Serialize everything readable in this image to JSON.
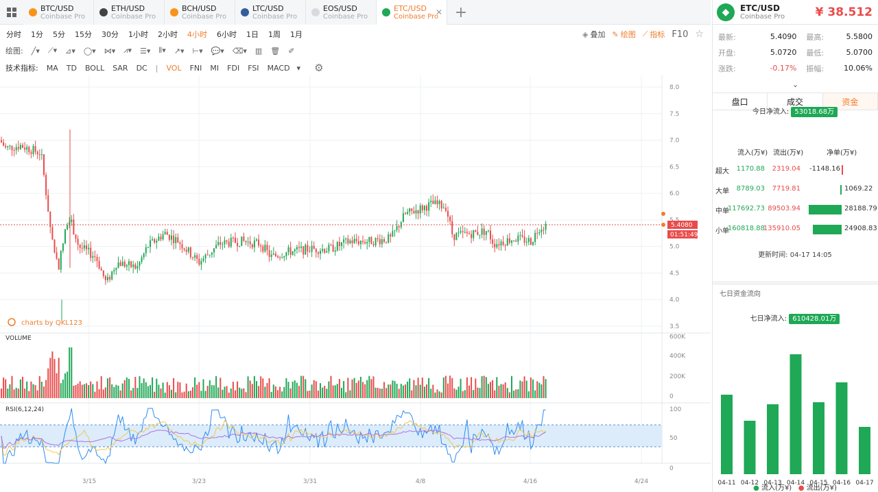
{
  "tabs": [
    {
      "symbol": "BTC/USD",
      "exchange": "Coinbase Pro",
      "color": "#f7931a",
      "active": false
    },
    {
      "symbol": "ETH/USD",
      "exchange": "Coinbase Pro",
      "color": "#444444",
      "active": false
    },
    {
      "symbol": "BCH/USD",
      "exchange": "Coinbase Pro",
      "color": "#f7931a",
      "active": false
    },
    {
      "symbol": "LTC/USD",
      "exchange": "Coinbase Pro",
      "color": "#345d9d",
      "active": false
    },
    {
      "symbol": "EOS/USD",
      "exchange": "Coinbase Pro",
      "color": "#d9d9e0",
      "active": false
    },
    {
      "symbol": "ETC/USD",
      "exchange": "Coinbase Pro",
      "color": "#1fa855",
      "active": true
    }
  ],
  "periods": [
    "分时",
    "1分",
    "5分",
    "15分",
    "30分",
    "1小时",
    "2小时",
    "4小时",
    "6小时",
    "1日",
    "1周",
    "1月"
  ],
  "active_period": "4小时",
  "toolbar_right": {
    "overlay": "叠加",
    "draw": "绘图",
    "indicator": "指标",
    "f10": "F10"
  },
  "draw_label": "绘图:",
  "indicator_label": "技术指标:",
  "indicators": [
    "MA",
    "TD",
    "BOLL",
    "SAR",
    "DC",
    "VOL",
    "FNI",
    "MI",
    "FDI",
    "FSI",
    "MACD"
  ],
  "active_indicator": "VOL",
  "chart_labels": {
    "watermark": "charts by QKL123",
    "volume": "VOLUME",
    "rsi": "RSI(6,12,24)",
    "price_tag": "5.4080",
    "countdown": "01:51:49"
  },
  "chart_data": {
    "type": "candlestick",
    "price_axis": [
      "8.0",
      "7.5",
      "7.0",
      "6.5",
      "6.0",
      "5.5",
      "5.0",
      "4.5",
      "4.0",
      "3.5"
    ],
    "volume_axis": [
      "600K",
      "400K",
      "200K",
      "0"
    ],
    "rsi_axis": [
      "100",
      "50",
      "0"
    ],
    "x_ticks": [
      "3/15",
      "3/23",
      "3/31",
      "4/8",
      "4/16",
      "4/24"
    ],
    "last_price": 5.408,
    "rsi_bands": [
      70,
      30
    ]
  },
  "header": {
    "pair": "ETC/USD",
    "exchange": "Coinbase Pro",
    "price": "¥ 38.512"
  },
  "stats": [
    {
      "k1": "最新:",
      "v1": "5.4090",
      "k2": "最高:",
      "v2": "5.5800"
    },
    {
      "k1": "开盘:",
      "v1": "5.0720",
      "k2": "最低:",
      "v2": "5.0700"
    },
    {
      "k1": "涨跌:",
      "v1": "-0.17%",
      "k2": "振幅:",
      "v2": "10.06%"
    }
  ],
  "right_tabs": [
    "盘口",
    "成交",
    "资金"
  ],
  "active_right_tab": "资金",
  "today": {
    "label": "今日净流入:",
    "value": "53018.68万"
  },
  "flow_header": [
    "流入(万¥)",
    "流出(万¥)",
    "净单(万¥)"
  ],
  "flows": [
    {
      "name": "超大",
      "in": "1170.88",
      "out": "2319.04",
      "net": "-1148.16",
      "net_value": -1148.16
    },
    {
      "name": "大单",
      "in": "8789.03",
      "out": "7719.81",
      "net": "1069.22",
      "net_value": 1069.22
    },
    {
      "name": "中单",
      "in": "117692.73",
      "out": "89503.94",
      "net": "28188.79",
      "net_value": 28188.79
    },
    {
      "name": "小单",
      "in": "160818.88",
      "out": "135910.05",
      "net": "24908.83",
      "net_value": 24908.83
    }
  ],
  "update_time": "更新时间:  04-17 14:05",
  "seven_day": {
    "title": "七日资金流向",
    "label": "七日净流入:",
    "value": "610428.01万",
    "days": [
      "04-11",
      "04-12",
      "04-13",
      "04-14",
      "04-15",
      "04-16",
      "04-17"
    ],
    "values": [
      116,
      78,
      102,
      175,
      105,
      134,
      69
    ],
    "legend_in": "流入(万¥)",
    "legend_out": "流出(万¥)"
  },
  "colors": {
    "accent": "#f07c2c",
    "up": "#1fa855",
    "down": "#e94b4b"
  }
}
